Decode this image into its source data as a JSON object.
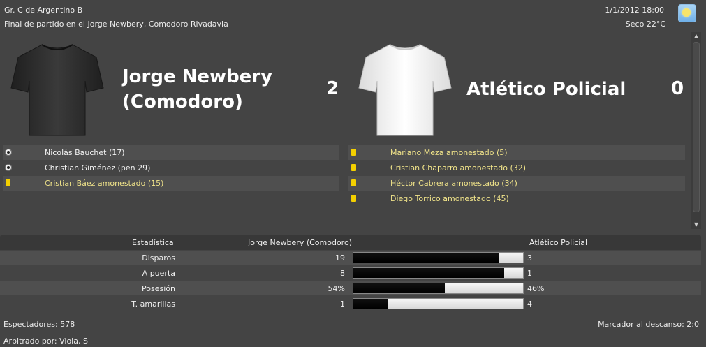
{
  "header": {
    "competition": "Gr. C de Argentino B",
    "venue_line": "Final de partido en el Jorge Newbery, Comodoro Rivadavia",
    "datetime": "1/1/2012 18:00",
    "weather": "Seco 22°C",
    "weather_icon": "sunny-icon"
  },
  "home": {
    "name": "Jorge Newbery (Comodoro)",
    "score": "2",
    "shirt_color": "#2e2e2e"
  },
  "away": {
    "name": "Atlético Policial",
    "score": "0",
    "shirt_color": "#eeeeee"
  },
  "home_events": [
    {
      "type": "goal",
      "text": "Nicolás Bauchet (17)"
    },
    {
      "type": "goal",
      "text": "Christian Giménez (pen 29)"
    },
    {
      "type": "yellow-card",
      "text": "Cristian Báez amonestado (15)"
    }
  ],
  "away_events": [
    {
      "type": "yellow-card",
      "text": "Mariano Meza amonestado (5)"
    },
    {
      "type": "yellow-card",
      "text": "Cristian Chaparro amonestado (32)"
    },
    {
      "type": "yellow-card",
      "text": "Héctor Cabrera amonestado (34)"
    },
    {
      "type": "yellow-card",
      "text": "Diego Torrico amonestado (45)"
    }
  ],
  "stats": {
    "header_label": "Estadística",
    "header_home": "Jorge Newbery (Comodoro)",
    "header_away": "Atlético Policial",
    "rows": [
      {
        "label": "Disparos",
        "home": "19",
        "away": "3",
        "home_share": 0.86
      },
      {
        "label": "A puerta",
        "home": "8",
        "away": "1",
        "home_share": 0.89
      },
      {
        "label": "Posesión",
        "home": "54%",
        "away": "46%",
        "home_share": 0.54
      },
      {
        "label": "T. amarillas",
        "home": "1",
        "away": "4",
        "home_share": 0.2
      }
    ]
  },
  "footer": {
    "spectators": "Espectadores: 578",
    "halftime": "Marcador al descanso: 2:0",
    "referee": "Arbitrado por: Viola, S"
  },
  "colors": {
    "background": "#444444",
    "yellow_text": "#f1e48a",
    "card": "#f4d000"
  }
}
